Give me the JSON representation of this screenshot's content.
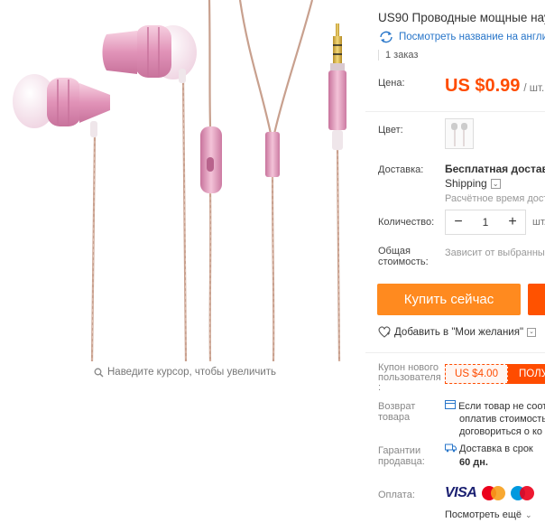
{
  "product": {
    "title": "US90 Проводные мощные нау",
    "translate_link": "Посмотреть название на англи",
    "orders": "1 заказ",
    "zoom_hint": "Наведите курсор, чтобы увеличить"
  },
  "price": {
    "label": "Цена:",
    "value": "US $0.99",
    "unit": "/ шт."
  },
  "color": {
    "label": "Цвет:"
  },
  "delivery": {
    "label": "Доставка:",
    "main": "Бесплатная доставка",
    "method": "Shipping",
    "time": "Расчётное время дост"
  },
  "quantity": {
    "label": "Количество:",
    "minus": "−",
    "value": "1",
    "plus": "+",
    "unit": "шт."
  },
  "total": {
    "label_line1": "Общая",
    "label_line2": "стоимость:",
    "text": "Зависит от выбранны"
  },
  "actions": {
    "buy_now": "Купить сейчас",
    "wishlist": "Добавить в \"Мои желания\""
  },
  "coupon": {
    "label_line1": "Купон нового",
    "label_line2": "пользователя",
    "label_line3": ":",
    "value": "US $4.00",
    "get": "ПОЛУ"
  },
  "returns": {
    "label_line1": "Возврат",
    "label_line2": "товара",
    "line1": "Если товар не соот",
    "line2": "оплатив стоимость",
    "line3": "договориться о ко"
  },
  "guarantee": {
    "label_line1": "Гарантии",
    "label_line2": "продавца:",
    "line1": "Доставка в срок",
    "line2": "60 дн."
  },
  "payment": {
    "label": "Оплата:",
    "visa": "VISA",
    "more": "Посмотреть ещё"
  },
  "colors": {
    "accent_orange": "#ff4c00",
    "buy_button": "#ff8a1f",
    "link_blue": "#2775c9",
    "earbud_pink": "#e8a7c4"
  },
  "icons": [
    "search-icon",
    "translate-icon",
    "chevron-down-icon",
    "heart-icon",
    "return-icon",
    "truck-icon",
    "mastercard-icon",
    "maestro-icon"
  ]
}
